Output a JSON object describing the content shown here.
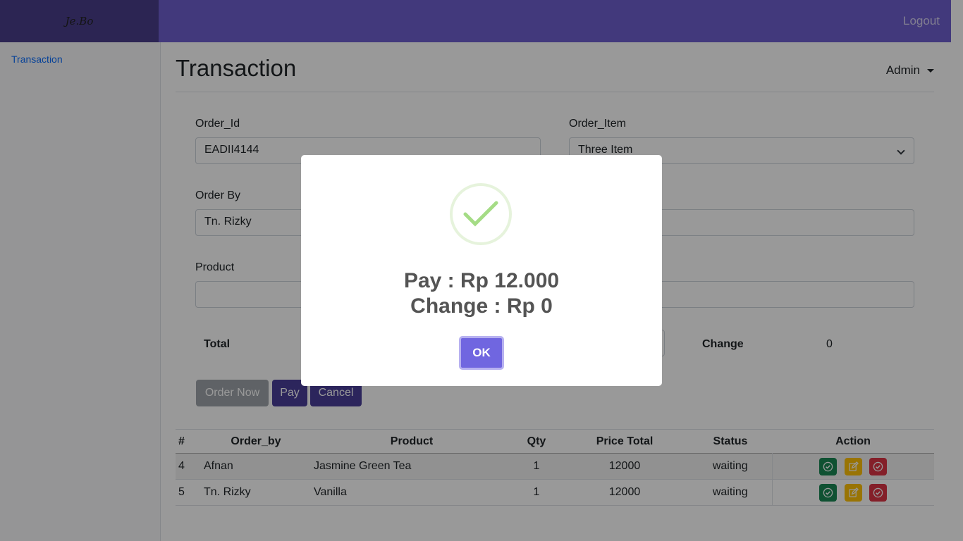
{
  "navbar": {
    "brand": "Je.Bo",
    "logout": "Logout"
  },
  "sidebar": {
    "items": [
      {
        "label": "Transaction"
      }
    ]
  },
  "header": {
    "title": "Transaction",
    "user": "Admin"
  },
  "form": {
    "order_id": {
      "label": "Order_Id",
      "value": "EADII4144"
    },
    "order_item": {
      "label": "Order_Item",
      "value": "Three Item"
    },
    "order_by": {
      "label": "Order By",
      "value": "Tn. Rizky"
    },
    "product": {
      "label": "Product",
      "value": ""
    },
    "total_label": "Total",
    "change_label": "Change",
    "change_value": "0"
  },
  "buttons": {
    "order_now": "Order Now",
    "pay": "Pay",
    "cancel": "Cancel"
  },
  "table": {
    "headers": [
      "#",
      "Order_by",
      "Product",
      "Qty",
      "Price Total",
      "Status",
      "Action"
    ],
    "rows": [
      {
        "id": "4",
        "order_by": "Afnan",
        "product": "Jasmine Green Tea",
        "qty": "1",
        "price_total": "12000",
        "status": "waiting"
      },
      {
        "id": "5",
        "order_by": "Tn. Rizky",
        "product": "Vanilla",
        "qty": "1",
        "price_total": "12000",
        "status": "waiting"
      }
    ]
  },
  "modal": {
    "line1": "Pay : Rp 12.000",
    "line2": "Change : Rp 0",
    "ok": "OK",
    "icon": "checkmark-success-icon"
  },
  "colors": {
    "navbar": "#6f5fcf",
    "brand_bg": "#4a3f8a",
    "primary": "#4a3f9a",
    "ok_button": "#7066e0",
    "success": "#a5dc86"
  }
}
